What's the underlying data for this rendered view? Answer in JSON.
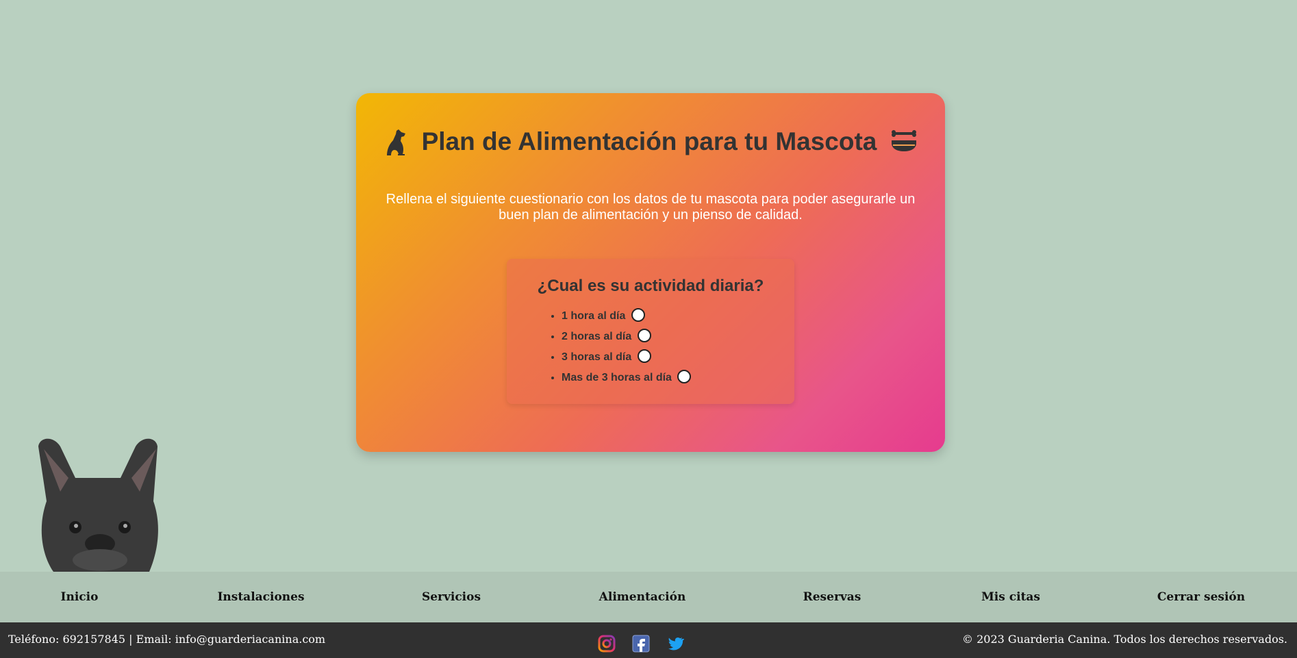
{
  "card": {
    "title": "Plan de Alimentación para tu Mascota",
    "intro": "Rellena el siguiente cuestionario con los datos de tu mascota para poder asegurarle un buen plan de alimentación y un pienso de calidad.",
    "left_icon": "dog-icon",
    "right_icon": "food-bowl-icon"
  },
  "quiz": {
    "question": "¿Cual es su actividad diaria?",
    "options": [
      "1 hora al día",
      "2 horas al día",
      "3 horas al día",
      "Mas de 3 horas al día"
    ]
  },
  "nav": {
    "items": [
      "Inicio",
      "Instalaciones",
      "Servicios",
      "Alimentación",
      "Reservas",
      "Mis citas",
      "Cerrar sesión"
    ]
  },
  "footer": {
    "contact": "Teléfono: 692157845 | Email: info@guarderiacanina.com",
    "copyright": "© 2023 Guarderia Canina. Todos los derechos reservados.",
    "social": [
      "instagram-icon",
      "facebook-icon",
      "twitter-icon"
    ]
  },
  "colors": {
    "background": "#b9d0c0",
    "card_gradient_start": "#f2b705",
    "card_gradient_end": "#e63b8e",
    "nav_background": "#b0c5b6",
    "footer_background": "#303030"
  }
}
